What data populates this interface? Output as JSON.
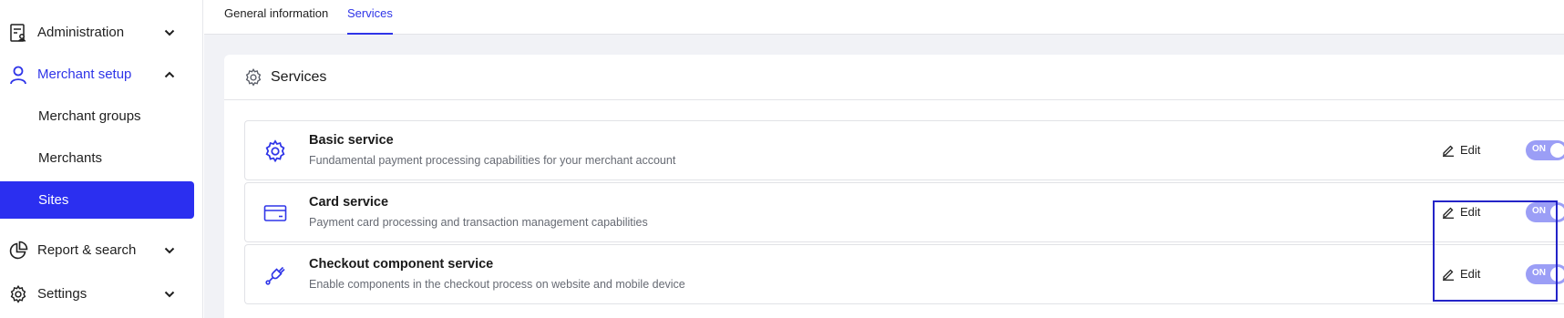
{
  "sidebar": {
    "items": [
      {
        "label": "Administration",
        "icon": "clipboard-user-icon",
        "expanded": false
      },
      {
        "label": "Merchant setup",
        "icon": "user-icon",
        "expanded": true
      },
      {
        "label": "Report & search",
        "icon": "pie-chart-icon",
        "expanded": false
      },
      {
        "label": "Settings",
        "icon": "gear-icon",
        "expanded": false
      }
    ],
    "subitems": [
      {
        "label": "Merchant groups",
        "selected": false
      },
      {
        "label": "Merchants",
        "selected": false
      },
      {
        "label": "Sites",
        "selected": true
      }
    ]
  },
  "tabs": [
    {
      "label": "General information",
      "active": false
    },
    {
      "label": "Services",
      "active": true
    }
  ],
  "services_card": {
    "title": "Services",
    "edit_label": "Edit",
    "toggle_label": "ON",
    "rows": [
      {
        "name": "Basic service",
        "description": "Fundamental payment processing capabilities for your merchant account",
        "icon": "gear-icon",
        "enabled": true
      },
      {
        "name": "Card service",
        "description": "Payment card processing and transaction management capabilities",
        "icon": "credit-card-icon",
        "enabled": true
      },
      {
        "name": "Checkout component service",
        "description": "Enable components in the checkout process on website and mobile device",
        "icon": "plug-icon",
        "enabled": true
      }
    ]
  },
  "colors": {
    "accent": "#2f35e8",
    "selected_bg": "#2b2ff0",
    "toggle_on": "#9b9ef6",
    "page_bg": "#f1f2f6",
    "highlight": "#2424c8"
  }
}
